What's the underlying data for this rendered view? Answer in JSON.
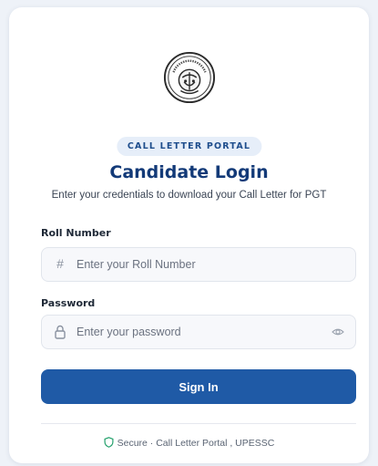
{
  "portal_badge": "CALL LETTER PORTAL",
  "title": "Candidate Login",
  "subtitle": "Enter your credentials to download your Call Letter for PGT",
  "roll": {
    "label": "Roll Number",
    "icon": "hash-icon",
    "placeholder": "Enter your Roll Number",
    "value": ""
  },
  "password": {
    "label": "Password",
    "icon": "lock-icon",
    "placeholder": "Enter your password",
    "value": "",
    "toggle_icon": "eye-icon"
  },
  "signin_label": "Sign In",
  "footer": {
    "icon": "shield-check-icon",
    "text": "Secure · Call Letter Portal , UPESSC"
  },
  "colors": {
    "primary": "#1f5aa6",
    "title": "#133a78",
    "badge_bg": "#e6eef9",
    "badge_text": "#1e4d8c",
    "secure_icon": "#22a06b"
  }
}
